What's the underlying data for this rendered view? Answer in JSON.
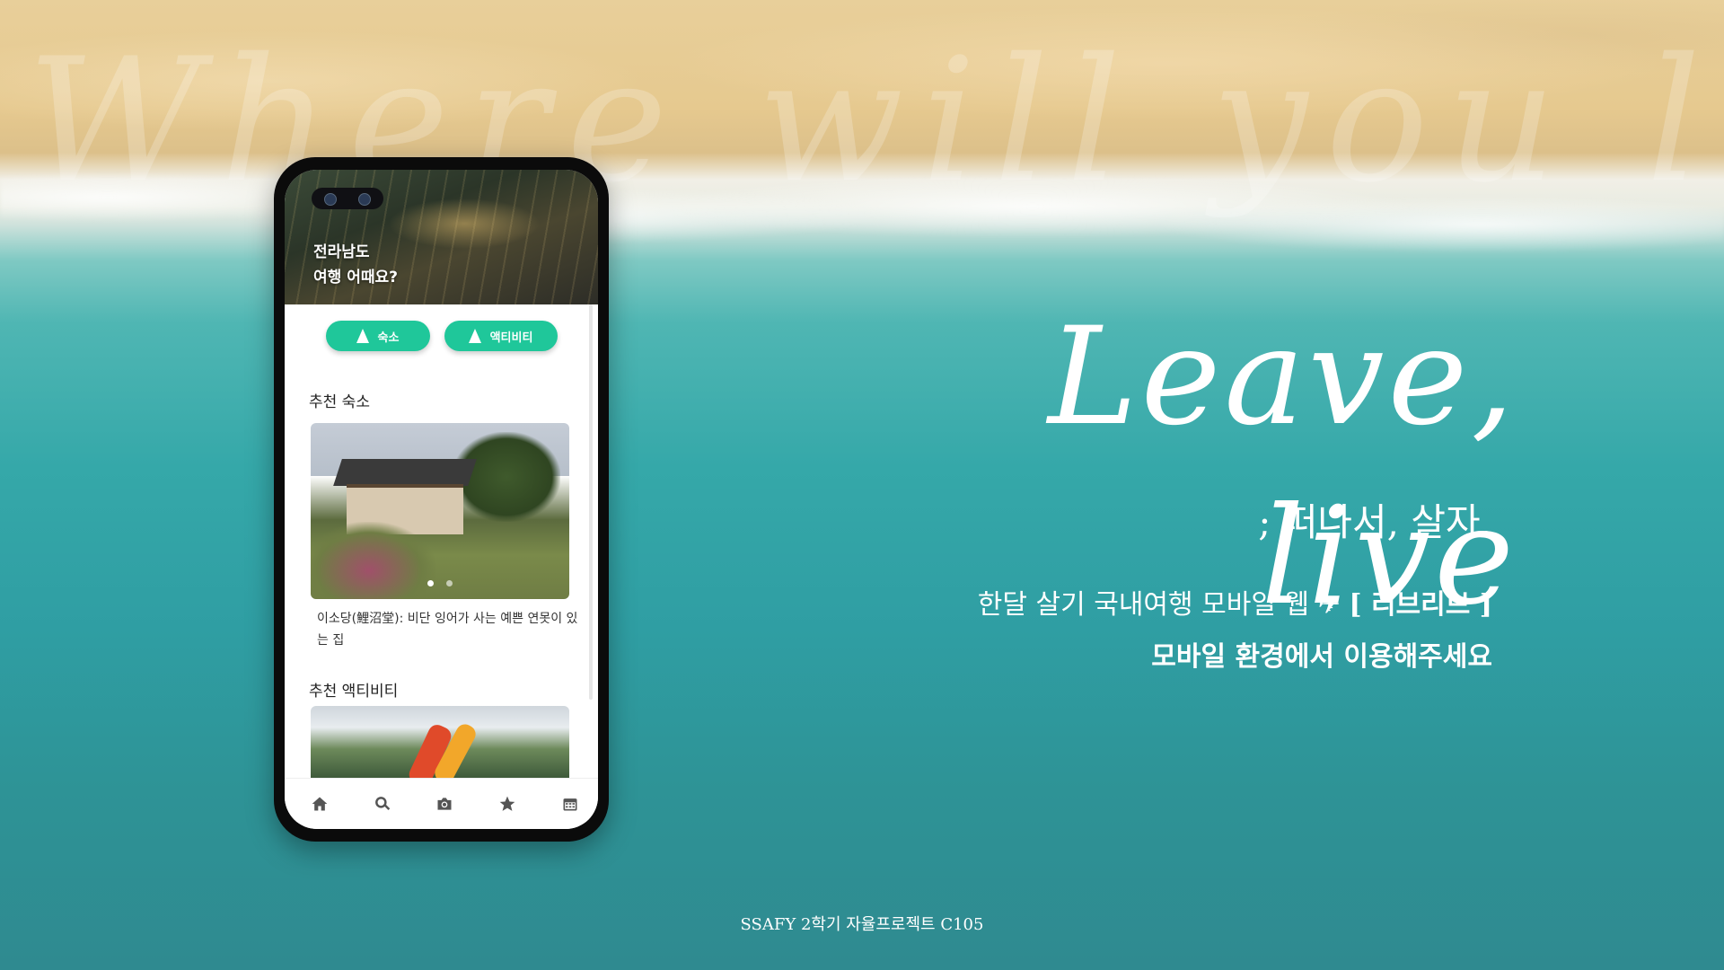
{
  "background": {
    "watermark_text": "Where will you live?"
  },
  "phone": {
    "hero": {
      "line1": "전라남도",
      "line2": "여행 어때요?"
    },
    "pills": [
      {
        "label": "숙소",
        "icon": "navigation-arrow-icon"
      },
      {
        "label": "액티비티",
        "icon": "navigation-arrow-icon"
      }
    ],
    "recommended_stay": {
      "title": "추천 숙소",
      "caption": "이소당(鯉沼堂): 비단 잉어가 사는 예쁜 연못이 있는 집",
      "carousel": {
        "count": 2,
        "active": 1
      }
    },
    "recommended_activity": {
      "title": "추천 액티비티"
    },
    "bottom_nav": [
      {
        "icon": "home-icon"
      },
      {
        "icon": "search-icon"
      },
      {
        "icon": "camera-icon"
      },
      {
        "icon": "star-icon"
      },
      {
        "icon": "calendar-icon"
      }
    ]
  },
  "hero_copy": {
    "script_title": "Leave, live",
    "subtitle": "; 떠나서, 살자.",
    "description_prefix": "한달 살기 국내여행 모바일 웹 ✈ ",
    "description_brand": "[ 리브리브 ]",
    "notice": "모바일 환경에서 이용해주세요"
  },
  "footer": {
    "text": "SSAFY 2학기 자율프로젝트 C105"
  },
  "colors": {
    "accent_green": "#1fc79a",
    "text_white": "#ffffff"
  }
}
